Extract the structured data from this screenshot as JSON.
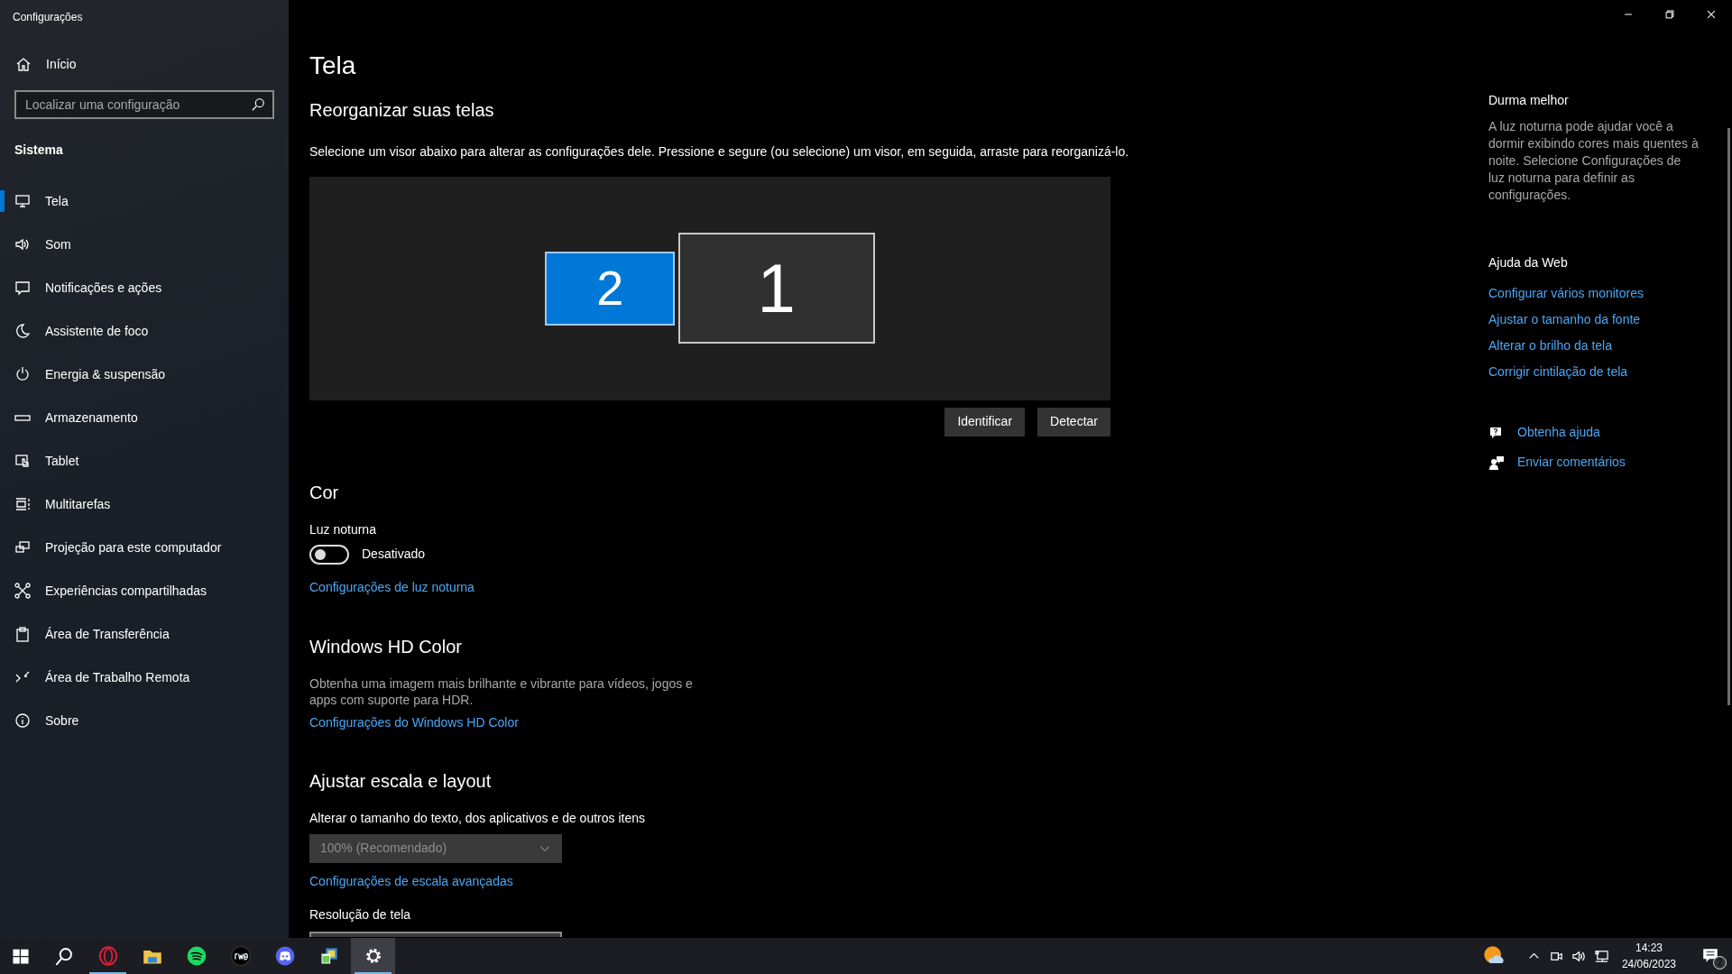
{
  "window": {
    "title": "Configurações"
  },
  "sidebar": {
    "home": "Início",
    "search": {
      "placeholder": "Localizar uma configuração"
    },
    "section": "Sistema",
    "items": [
      {
        "label": "Tela",
        "selected": true
      },
      {
        "label": "Som",
        "selected": false
      },
      {
        "label": "Notificações e ações",
        "selected": false
      },
      {
        "label": "Assistente de foco",
        "selected": false
      },
      {
        "label": "Energia & suspensão",
        "selected": false
      },
      {
        "label": "Armazenamento",
        "selected": false
      },
      {
        "label": "Tablet",
        "selected": false
      },
      {
        "label": "Multitarefas",
        "selected": false
      },
      {
        "label": "Projeção para este computador",
        "selected": false
      },
      {
        "label": "Experiências compartilhadas",
        "selected": false
      },
      {
        "label": "Área de Transferência",
        "selected": false
      },
      {
        "label": "Área de Trabalho Remota",
        "selected": false
      },
      {
        "label": "Sobre",
        "selected": false
      }
    ]
  },
  "main": {
    "title": "Tela",
    "arrange": {
      "heading": "Reorganizar suas telas",
      "description": "Selecione um visor abaixo para alterar as configurações dele. Pressione e segure (ou selecione) um visor, em seguida, arraste para reorganizá-lo.",
      "monitors": [
        {
          "label": "2",
          "selected": true
        },
        {
          "label": "1",
          "selected": false
        }
      ],
      "buttons": [
        "Identificar",
        "Detectar"
      ]
    },
    "color": {
      "heading": "Cor",
      "night_light": {
        "label": "Luz noturna",
        "on": false,
        "state": "Desativado"
      },
      "link": "Configurações de luz noturna"
    },
    "hd_color": {
      "heading": "Windows HD Color",
      "description": "Obtenha uma imagem mais brilhante e vibrante para vídeos, jogos e apps com suporte para HDR.",
      "link": "Configurações do Windows HD Color"
    },
    "scale": {
      "heading": "Ajustar escala e layout",
      "label": "Alterar o tamanho do texto, dos aplicativos e de outros itens",
      "dropdown": {
        "value": "100% (Recomendado)",
        "disabled": true
      },
      "link": "Configurações de escala avançadas",
      "resolution_label": "Resolução de tela"
    }
  },
  "aside": {
    "tip_heading": "Durma melhor",
    "tip": "A luz noturna pode ajudar você a dormir exibindo cores mais quentes à noite. Selecione Configurações de luz noturna para definir as configurações.",
    "web_heading": "Ajuda da Web",
    "web_links": [
      "Configurar vários monitores",
      "Ajustar o tamanho da fonte",
      "Alterar o brilho da tela",
      "Corrigir cintilação de tela"
    ],
    "actions": [
      "Obtenha ajuda",
      "Enviar comentários"
    ]
  },
  "taskbar": {
    "apps": [
      {
        "running": false,
        "selected": false
      },
      {
        "running": false,
        "selected": false
      },
      {
        "running": true,
        "selected": false
      },
      {
        "running": false,
        "selected": false
      },
      {
        "running": false,
        "selected": false
      },
      {
        "running": false,
        "selected": false
      },
      {
        "running": false,
        "selected": false
      },
      {
        "running": false,
        "selected": false
      },
      {
        "running": true,
        "selected": true
      }
    ],
    "time": "14:23",
    "date": "24/06/2023",
    "notifications": "2"
  }
}
